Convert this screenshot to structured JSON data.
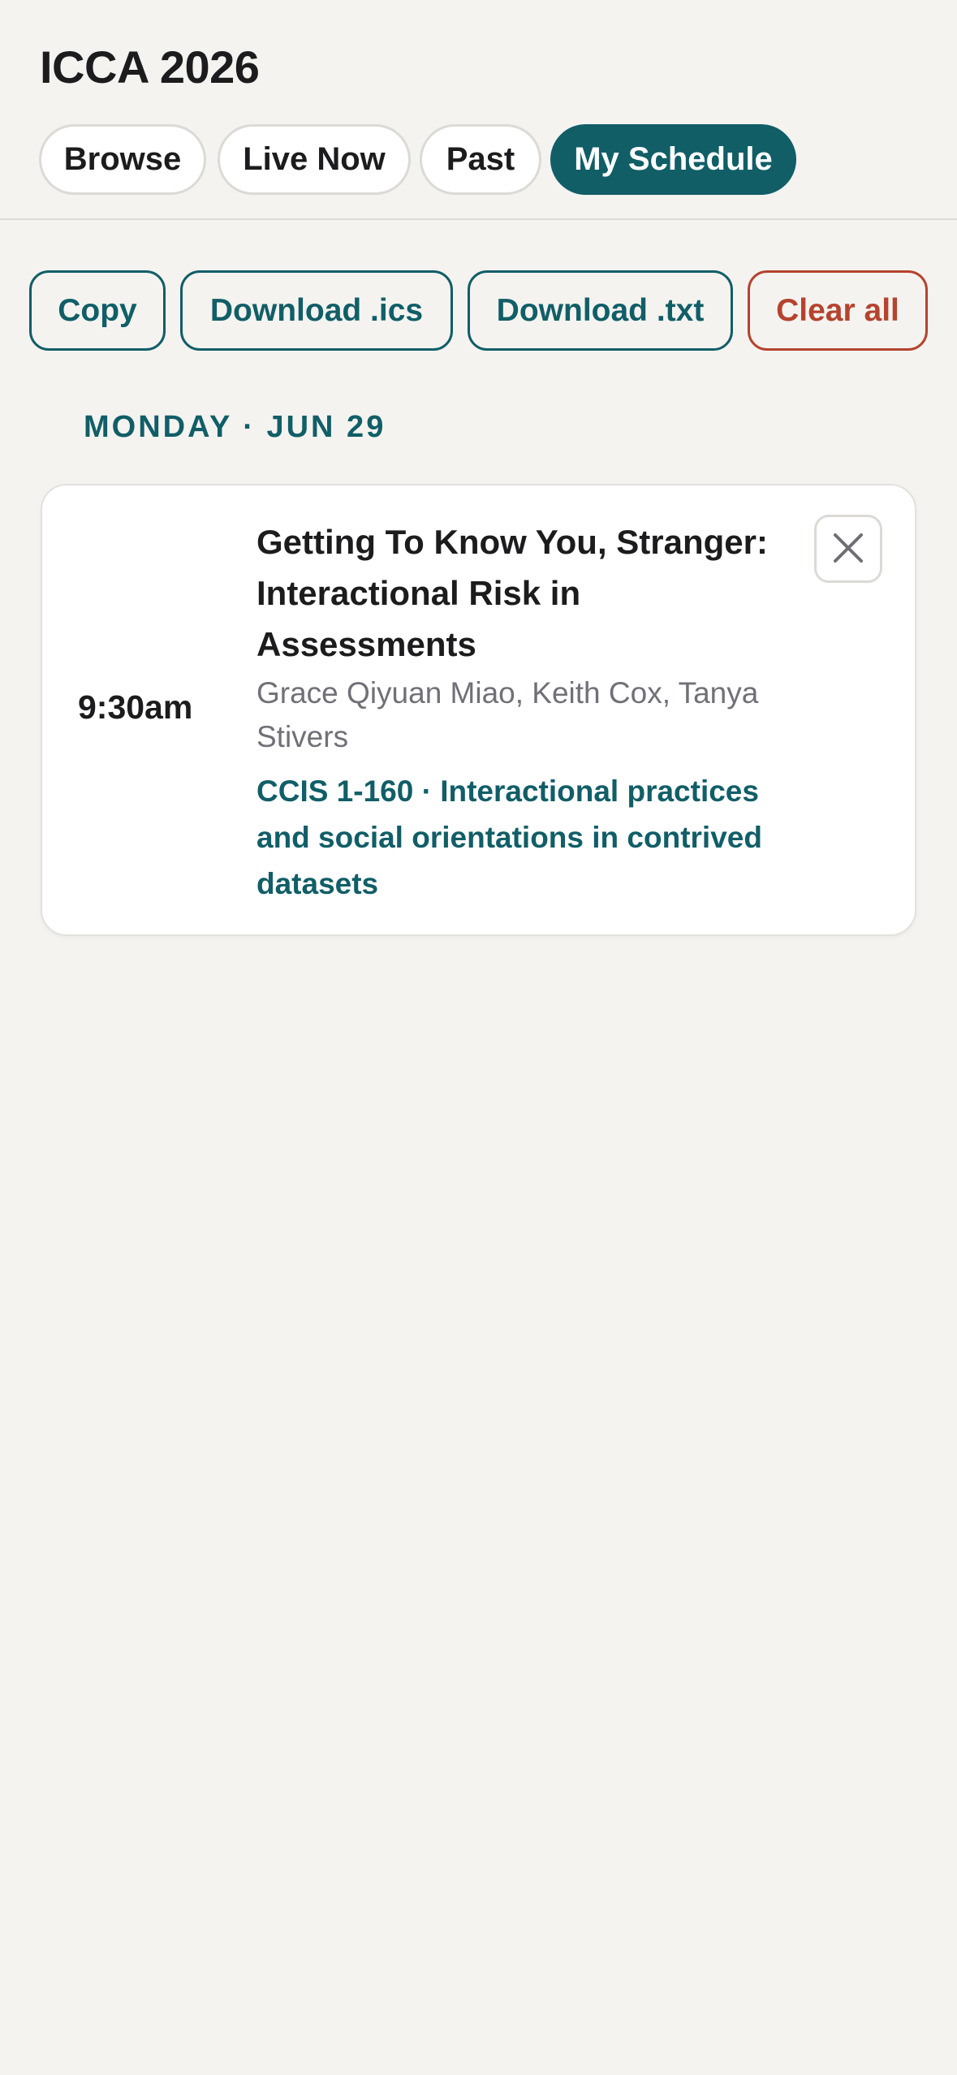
{
  "app": {
    "title": "ICCA 2026"
  },
  "tabs": [
    {
      "label": "Browse",
      "active": false
    },
    {
      "label": "Live Now",
      "active": false
    },
    {
      "label": "Past",
      "active": false
    },
    {
      "label": "My Schedule",
      "active": true
    }
  ],
  "actions": {
    "copy": "Copy",
    "download_ics": "Download .ics",
    "download_txt": "Download .txt",
    "clear_all": "Clear all"
  },
  "schedule": {
    "days": [
      {
        "heading": "MONDAY · JUN 29",
        "sessions": [
          {
            "time": "9:30am",
            "title": "Getting To Know You, Stranger: Interactional Risk in Assessments",
            "authors": "Grace Qiyuan Miao, Keith Cox, Tanya Stivers",
            "session": "CCIS 1-160 · Interactional practices and social orientations in contrived datasets",
            "remove_icon": "close-icon"
          }
        ]
      }
    ]
  },
  "colors": {
    "accent": "#115e67",
    "danger": "#b5432e",
    "background": "#f4f3f0",
    "muted_text": "#707078"
  }
}
